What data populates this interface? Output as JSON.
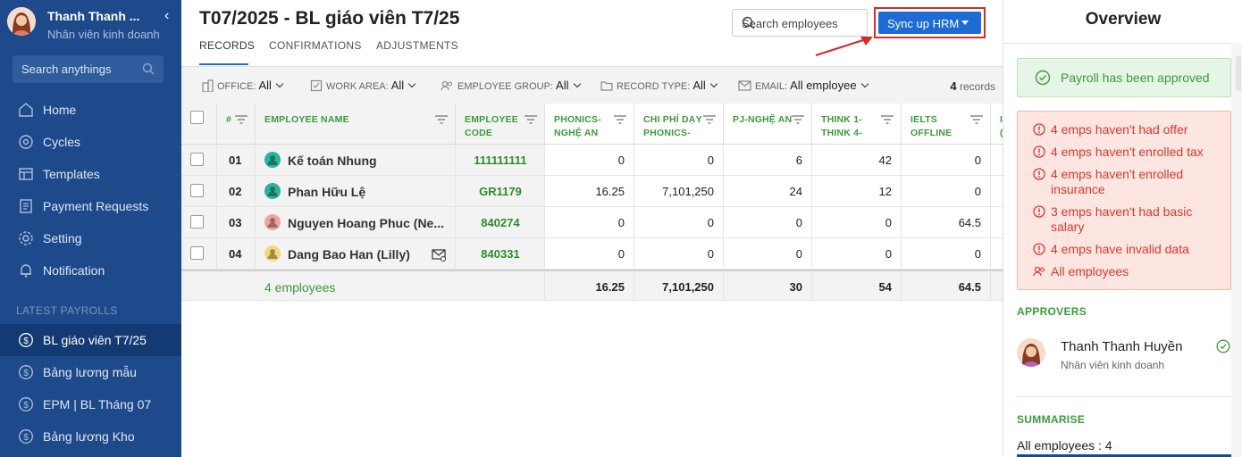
{
  "sidebar": {
    "user": {
      "name": "Thanh Thanh ...",
      "role": "Nhân viên kinh doanh"
    },
    "search_placeholder": "Search anythings",
    "nav": [
      {
        "label": "Home",
        "icon": "home-icon"
      },
      {
        "label": "Cycles",
        "icon": "cycles-icon"
      },
      {
        "label": "Templates",
        "icon": "templates-icon"
      },
      {
        "label": "Payment Requests",
        "icon": "payment-requests-icon"
      },
      {
        "label": "Setting",
        "icon": "gear-icon"
      },
      {
        "label": "Notification",
        "icon": "bell-icon"
      }
    ],
    "latest_label": "LATEST PAYROLLS",
    "payrolls": [
      {
        "label": "BL giáo viên T7/25",
        "active": true
      },
      {
        "label": "Bảng lương mẫu"
      },
      {
        "label": "EPM | BL Tháng 07"
      },
      {
        "label": "Bảng lương Kho"
      }
    ]
  },
  "main": {
    "title": "T07/2025 - BL giáo viên T7/25",
    "tabs": [
      "RECORDS",
      "CONFIRMATIONS",
      "ADJUSTMENTS"
    ],
    "search_placeholder": "Search employees",
    "sync_label": "Sync up HRM",
    "filters": [
      {
        "label": "OFFICE:",
        "value": "All"
      },
      {
        "label": "WORK AREA:",
        "value": "All"
      },
      {
        "label": "EMPLOYEE GROUP:",
        "value": "All"
      },
      {
        "label": "RECORD TYPE:",
        "value": "All"
      },
      {
        "label": "EMAIL:",
        "value": "All employee"
      }
    ],
    "records_count": "4",
    "records_label": "records"
  },
  "table": {
    "headers": {
      "num": "#",
      "name": "EMPLOYEE NAME",
      "code": [
        "EMPLOYEE",
        "CODE"
      ],
      "c1": [
        "PHONICS-",
        "NGHỆ AN"
      ],
      "c2": [
        "CHI PHÍ DẠY",
        "PHONICS-"
      ],
      "c3": [
        "PJ-NGHỆ AN",
        ""
      ],
      "c4": [
        "THINK 1-",
        "THINK 4-"
      ],
      "c5": [
        "IELTS",
        "OFFLINE"
      ],
      "c6": [
        "I",
        "("
      ]
    },
    "rows": [
      {
        "num": "01",
        "name": "Kế toán Nhung",
        "code": "111111111",
        "c1": "0",
        "c2": "0",
        "c3": "6",
        "c4": "42",
        "c5": "0",
        "avatar_color": "#2bb39b"
      },
      {
        "num": "02",
        "name": "Phan Hữu Lệ",
        "code": "GR1179",
        "c1": "16.25",
        "c2": "7,101,250",
        "c3": "24",
        "c4": "12",
        "c5": "0",
        "avatar_color": "#2bb39b"
      },
      {
        "num": "03",
        "name": "Nguyen Hoang Phuc (Ne...",
        "code": "840274",
        "c1": "0",
        "c2": "0",
        "c3": "0",
        "c4": "0",
        "c5": "64.5",
        "avatar_color": "#f0a49b"
      },
      {
        "num": "04",
        "name": "Dang Bao Han (Lilly)",
        "code": "840331",
        "c1": "0",
        "c2": "0",
        "c3": "0",
        "c4": "0",
        "c5": "0",
        "avatar_color": "#f7d87a"
      }
    ],
    "footer": {
      "label": "4 employees",
      "c1": "16.25",
      "c2": "7,101,250",
      "c3": "30",
      "c4": "54",
      "c5": "64.5"
    }
  },
  "panel": {
    "title": "Overview",
    "approved": "Payroll has been approved",
    "warnings": [
      "4 emps haven't had offer",
      "4 emps haven't enrolled tax",
      "4 emps haven't enrolled insurance",
      "3 emps haven't had basic salary",
      "4 emps have invalid data"
    ],
    "all_employees": "All employees",
    "approvers_label": "APPROVERS",
    "approver": {
      "name": "Thanh Thanh Huyền",
      "role": "Nhân viên kinh doanh"
    },
    "summarise_label": "SUMMARISE",
    "summarise_text": "All employees : 4"
  },
  "colors": {
    "sidebar": "#1e4a8c",
    "accent": "#1e6bd6",
    "green": "#3b9b3b",
    "error": "#d9382c",
    "highlight_border": "#d42b2b"
  }
}
